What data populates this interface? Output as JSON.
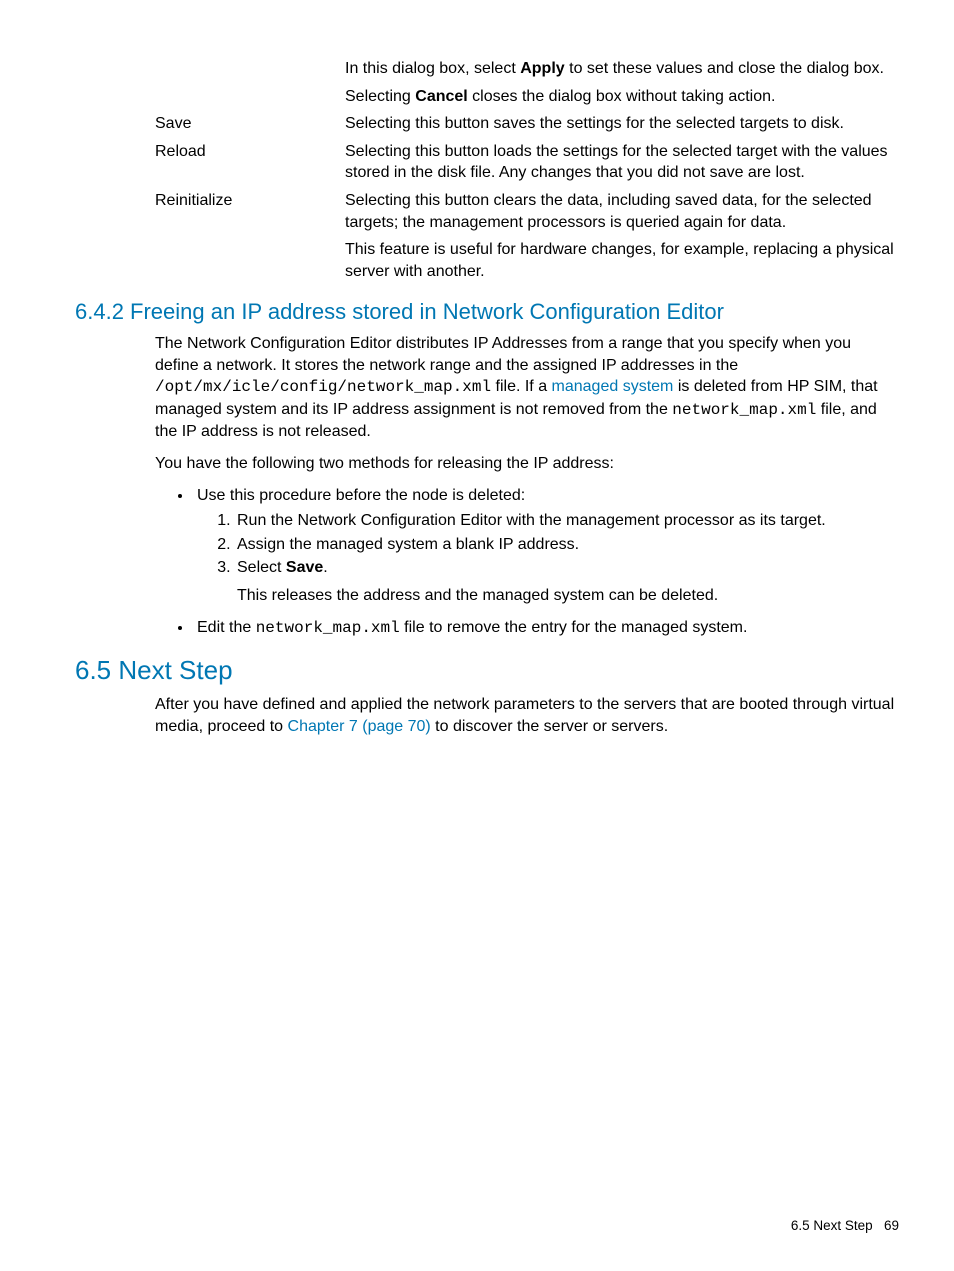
{
  "defs": {
    "blank": {
      "term": "",
      "p1a": "In this dialog box, select ",
      "p1b": "Apply",
      "p1c": " to set these values and close the dialog box.",
      "p2a": "Selecting ",
      "p2b": "Cancel",
      "p2c": " closes the dialog box without taking action."
    },
    "save": {
      "term": "Save",
      "desc": "Selecting this button saves the settings for the selected targets to disk."
    },
    "reload": {
      "term": "Reload",
      "desc": "Selecting this button loads the settings for the selected target with the values stored in the disk file. Any changes that you did not save are lost."
    },
    "reinit": {
      "term": "Reinitialize",
      "p1": "Selecting this button clears the data, including saved data, for the selected targets; the management processors is queried again for data.",
      "p2": "This feature is useful for hardware changes, for example, replacing a physical server with another."
    }
  },
  "h642": "6.4.2 Freeing an IP address stored in Network Configuration Editor",
  "sec642": {
    "p1a": "The Network Configuration Editor distributes IP Addresses from a range that you specify when you define a network. It stores the network range and the assigned IP addresses in the ",
    "code1": "/opt/mx/icle/config/network_map.xml",
    "p1b": " file. If a ",
    "link1": "managed system",
    "p1c": " is deleted from HP SIM, that managed system and its IP address assignment is not removed from the ",
    "code2": "network_map.xml",
    "p1d": " file, and the IP address is not released.",
    "p2": "You have the following two methods for releasing the IP address:",
    "b1intro": "Use this procedure before the node is deleted:",
    "s1": "Run the Network Configuration Editor with the management processor as its target.",
    "s2": "Assign the managed system a blank IP address.",
    "s3a": "Select ",
    "s3b": "Save",
    "s3c": ".",
    "b1after": "This releases the address and the managed system can be deleted.",
    "b2a": "Edit the ",
    "b2code": "network_map.xml",
    "b2b": " file to remove the entry for the managed system."
  },
  "h65": "6.5 Next Step",
  "sec65": {
    "p1a": "After you have defined and applied the network parameters to the servers that are booted through virtual media, proceed to ",
    "link": "Chapter 7 (page 70)",
    "p1b": " to discover the server or servers."
  },
  "footer": {
    "label": "6.5 Next Step",
    "page": "69"
  }
}
